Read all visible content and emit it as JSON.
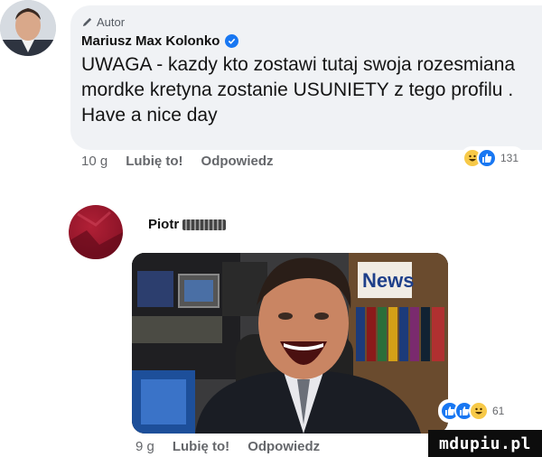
{
  "comment1": {
    "author_badge": "Autor",
    "author_name": "Mariusz Max Kolonko",
    "text": "UWAGA - kazdy kto zostawi tutaj swoja rozesmiana mordke kretyna zostanie USUNIETY z tego profilu . Have a nice day",
    "time": "10 g",
    "like_label": "Lubię to!",
    "reply_label": "Odpowiedz",
    "reaction_count": "131",
    "reactions": [
      "haha-icon",
      "like-icon"
    ]
  },
  "comment2": {
    "author_name": "Piotr",
    "photo_sign": "News",
    "time": "9 g",
    "like_label": "Lubię to!",
    "reply_label": "Odpowiedz",
    "reaction_count": "61",
    "reactions": [
      "like-icon",
      "love-icon",
      "haha-icon"
    ]
  },
  "watermark": "mdupiu.pl",
  "colors": {
    "bubble": "#f0f2f5",
    "facebook_blue": "#1877f2",
    "action_text": "#65676b",
    "avatar2": "#9a1a2e"
  }
}
